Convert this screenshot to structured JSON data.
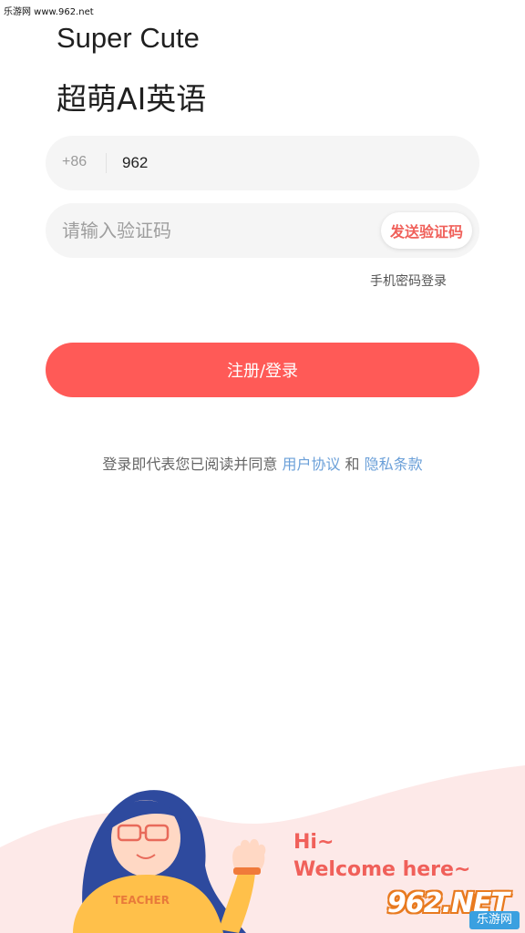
{
  "watermark": {
    "top_text": "乐游网 www.962.net"
  },
  "header": {
    "title_en": "Super Cute",
    "title_cn": "超萌AI英语"
  },
  "form": {
    "country_code": "+86",
    "phone_value": "962",
    "code_placeholder": "请输入验证码",
    "send_code_label": "发送验证码",
    "password_login_label": "手机密码登录",
    "submit_label": "注册/登录"
  },
  "agreement": {
    "prefix": "登录即代表您已阅读并同意",
    "user_agreement": "用户协议",
    "conjunction": "和",
    "privacy_policy": "隐私条款"
  },
  "illustration": {
    "greeting_line1": "Hi~",
    "greeting_line2": "Welcome here~",
    "shirt_text": "TEACHER"
  },
  "brand_watermark": {
    "number": "962",
    "dot_net": ".NET",
    "site_cn": "乐游网"
  },
  "colors": {
    "accent": "#ff5a57",
    "link": "#6a9fd8",
    "field_bg": "#f5f5f5"
  }
}
